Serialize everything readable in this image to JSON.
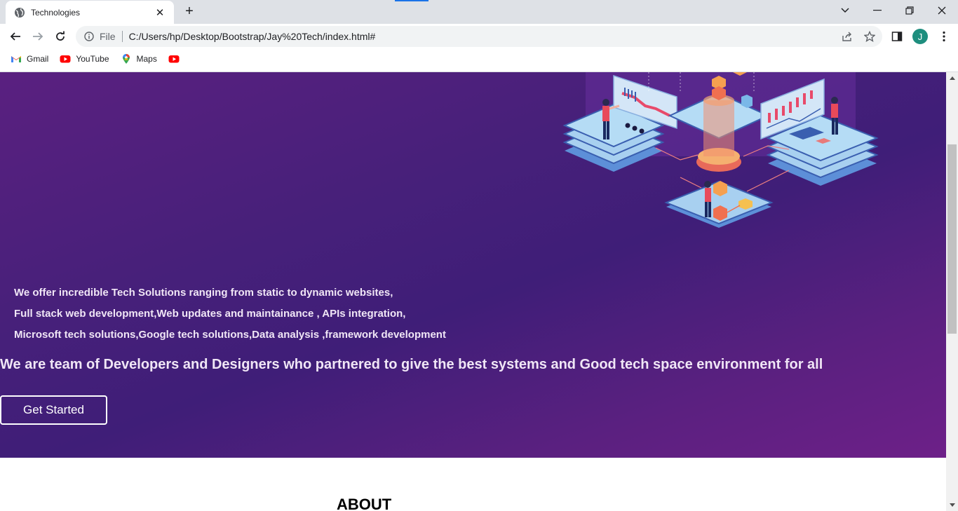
{
  "browser": {
    "tab_title": "Technologies",
    "address_prefix": "File",
    "url": "C:/Users/hp/Desktop/Bootstrap/Jay%20Tech/index.html#",
    "profile_initial": "J",
    "bookmarks": [
      {
        "label": "Gmail",
        "icon": "gmail-icon"
      },
      {
        "label": "YouTube",
        "icon": "youtube-icon"
      },
      {
        "label": "Maps",
        "icon": "maps-icon"
      },
      {
        "label": "",
        "icon": "youtube-icon"
      }
    ]
  },
  "hero": {
    "offer_lines": [
      "We offer incredible Tech Solutions ranging from static to dynamic websites,",
      "Full stack web development,Web updates and maintainance , APIs integration,",
      "Microsoft tech solutions,Google tech solutions,Data analysis ,framework development"
    ],
    "team_statement": "We are team of Developers and Designers who partnered to give the best systems and Good tech space environment for all",
    "cta_label": "Get Started"
  },
  "sections": {
    "about_heading": "ABOUT"
  },
  "colors": {
    "hero_gradient_start": "#5a2080",
    "hero_gradient_mid": "#3f1e78",
    "hero_gradient_end": "#6d2088",
    "profile_avatar": "#1e8e7e"
  }
}
